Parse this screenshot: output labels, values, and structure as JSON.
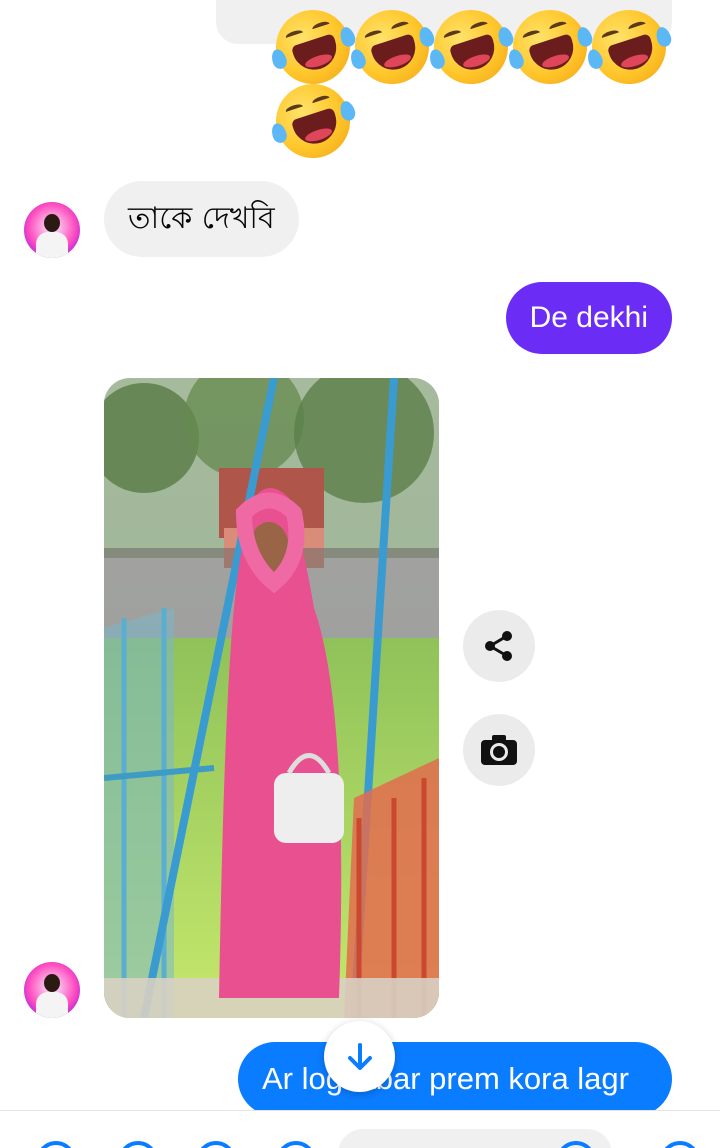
{
  "messages": {
    "top_emoji": {
      "row1": [
        "🤣",
        "🤣",
        "🤣",
        "🤣",
        "🤣"
      ],
      "row2": [
        "🤣"
      ]
    },
    "incoming_1": "তাকে দেখবি",
    "outgoing_1": "De dekhi",
    "outgoing_2": "Ar logi abar prem kora lagr"
  },
  "photo_actions": {
    "share_icon": "share-icon",
    "camera_icon": "camera-icon"
  },
  "colors": {
    "incoming_bubble": "#f0f0f0",
    "outgoing_purple": "#6b2cf5",
    "outgoing_blue": "#0a7cff"
  },
  "icons": {
    "scroll_down": "arrow-down-icon"
  }
}
